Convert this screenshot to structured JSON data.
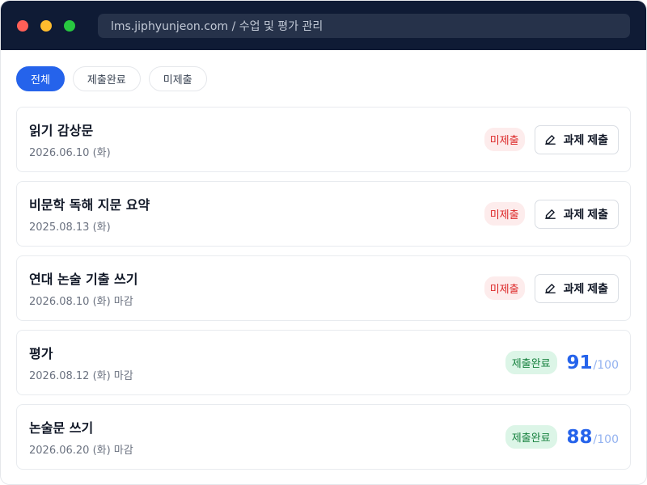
{
  "browser": {
    "url": "lms.jiphyunjeon.com / 수업 및 평가 관리"
  },
  "filters": [
    {
      "label": "전체",
      "active": true
    },
    {
      "label": "제출완료",
      "active": false
    },
    {
      "label": "미제출",
      "active": false
    }
  ],
  "items": [
    {
      "title": "읽기 감상문",
      "date": "2026.06.10 (화)",
      "status": "미제출",
      "action_label": "과제 제출"
    },
    {
      "title": "비문학 독해 지문 요약",
      "date": "2025.08.13 (화)",
      "status": "미제출",
      "action_label": "과제 제출"
    },
    {
      "title": "연대 논술 기출 쓰기",
      "date": "2026.08.10 (화) 마감",
      "status": "미제출",
      "action_label": "과제 제출"
    },
    {
      "title": "평가",
      "date": "2026.08.12 (화) 마감",
      "status": "제출완료",
      "score": "91",
      "score_max": "/100"
    },
    {
      "title": "논술문 쓰기",
      "date": "2026.06.20 (화) 마감",
      "status": "제출완료",
      "score": "88",
      "score_max": "/100"
    }
  ],
  "colors": {
    "accent": "#2563eb",
    "titlebar": "#0f1b35",
    "unsubmitted": "#dc2626",
    "submitted": "#15803d"
  },
  "icons": {
    "submit": "edit-pencil-icon"
  }
}
